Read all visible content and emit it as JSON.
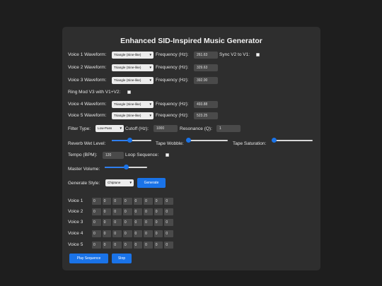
{
  "title": "Enhanced SID-Inspired Music Generator",
  "voices": [
    {
      "label": "Voice 1 Waveform:",
      "waveform": "Triangle (Sine-like)",
      "freq_label": "Frequency (Hz):",
      "freq": "261.63"
    },
    {
      "label": "Voice 2 Waveform:",
      "waveform": "Triangle (Sine-like)",
      "freq_label": "Frequency (Hz):",
      "freq": "329.63"
    },
    {
      "label": "Voice 3 Waveform:",
      "waveform": "Triangle (Sine-like)",
      "freq_label": "Frequency (Hz):",
      "freq": "392.00"
    },
    {
      "label": "Voice 4 Waveform:",
      "waveform": "Triangle (Sine-like)",
      "freq_label": "Frequency (Hz):",
      "freq": "493.88"
    },
    {
      "label": "Voice 5 Waveform:",
      "waveform": "Triangle (Sine-like)",
      "freq_label": "Frequency (Hz):",
      "freq": "523.25"
    }
  ],
  "sync_label": "Sync V2 to V1:",
  "ringmod_label": "Ring Mod V3 with V1+V2:",
  "filter": {
    "type_label": "Filter Type:",
    "type": "Low-Pass",
    "cutoff_label": "Cutoff (Hz):",
    "cutoff": "1000",
    "resonance_label": "Resonance (Q):",
    "resonance": "1"
  },
  "effects": {
    "reverb_label": "Reverb Wet Level:",
    "reverb_value": 0.45,
    "wobble_label": "Tape Wobble:",
    "wobble_value": 0.0,
    "saturation_label": "Tape Saturation:",
    "saturation_value": 0.02
  },
  "tempo_label": "Tempo (BPM):",
  "tempo": "120",
  "loop_label": "Loop Sequence:",
  "master_label": "Master Volume:",
  "master_value": 0.5,
  "style_label": "Generate Style:",
  "style": "Chiptune",
  "generate_label": "Generate",
  "sequence": [
    {
      "label": "Voice 1",
      "steps": [
        "0",
        "0",
        "0",
        "0",
        "0",
        "0",
        "0",
        "0"
      ]
    },
    {
      "label": "Voice 2",
      "steps": [
        "0",
        "0",
        "0",
        "0",
        "0",
        "0",
        "0",
        "0"
      ]
    },
    {
      "label": "Voice 3",
      "steps": [
        "0",
        "0",
        "0",
        "0",
        "0",
        "0",
        "0",
        "0"
      ]
    },
    {
      "label": "Voice 4",
      "steps": [
        "0",
        "0",
        "0",
        "0",
        "0",
        "0",
        "0",
        "0"
      ]
    },
    {
      "label": "Voice 5",
      "steps": [
        "0",
        "0",
        "0",
        "0",
        "0",
        "0",
        "0",
        "0"
      ]
    }
  ],
  "play_label": "Play Sequence",
  "stop_label": "Stop",
  "colors": {
    "accent": "#1a73e8",
    "panel": "#2e2e2e",
    "background": "#1e1e1e"
  }
}
